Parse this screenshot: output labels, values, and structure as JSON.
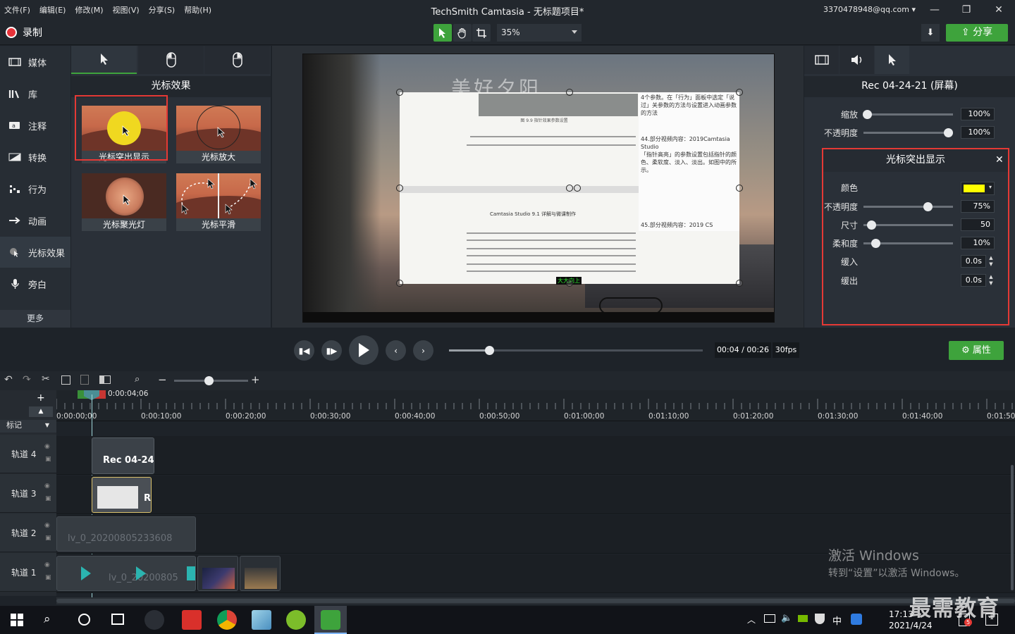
{
  "app": {
    "title": "TechSmith Camtasia - 无标题项目*",
    "menu": [
      "文件(F)",
      "编辑(E)",
      "修改(M)",
      "视图(V)",
      "分享(S)",
      "帮助(H)"
    ],
    "account": "3370478948@qq.com",
    "window_buttons": [
      "—",
      "❐",
      "✕"
    ]
  },
  "toolbar": {
    "record_label": "录制",
    "zoom": "35%",
    "share_label": "分享"
  },
  "sidebar": {
    "items": [
      {
        "label": "媒体",
        "icon": "film-icon"
      },
      {
        "label": "库",
        "icon": "library-icon"
      },
      {
        "label": "注释",
        "icon": "annotation-icon"
      },
      {
        "label": "转换",
        "icon": "transition-icon"
      },
      {
        "label": "行为",
        "icon": "behavior-icon"
      },
      {
        "label": "动画",
        "icon": "animation-icon"
      },
      {
        "label": "光标效果",
        "icon": "cursor-effect-icon",
        "active": true
      },
      {
        "label": "旁白",
        "icon": "microphone-icon"
      }
    ],
    "more_label": "更多"
  },
  "effects": {
    "title": "光标效果",
    "cards": [
      {
        "label": "光标突出显示"
      },
      {
        "label": "光标放大"
      },
      {
        "label": "光标聚光灯"
      },
      {
        "label": "光标平滑"
      }
    ]
  },
  "canvas": {
    "video_title": "美好夕阳",
    "doc_heading": "Camtasia Studio 9.1 详解与微课制作",
    "doc_caption": "图 9.9 指针效果参数设置",
    "doc_right": [
      "4个参数。在「行为」面板中选定「说过」关参数的方法与设置进入动画参数的方法",
      "44.部分视频内容：2019Camtasia Studio",
      "「指针高亮」的参数设置包括指针的颜色、柔软度、淡入、淡出。如图中的所示。",
      "45.部分视频内容：2019 CS"
    ],
    "subtitle": "大大向上"
  },
  "properties": {
    "tabs": [
      "film-icon",
      "audio-icon",
      "cursor-icon"
    ],
    "clip_name": "Rec 04-24-21 (屏幕)",
    "scale_label": "缩放",
    "scale_value": "100%",
    "scale_level": 0.0,
    "opacity_label": "不透明度",
    "opacity_value": "100%",
    "opacity_level": 1.0,
    "cursor_panel": {
      "title": "光标突出显示",
      "color_label": "颜色",
      "color": "#ffff00",
      "opacity_label": "不透明度",
      "opacity_value": "75%",
      "opacity_level": 0.75,
      "size_label": "尺寸",
      "size_value": "50",
      "size_level": 0.05,
      "softness_label": "柔和度",
      "softness_value": "10%",
      "softness_level": 0.1,
      "fade_in_label": "缓入",
      "fade_in_value": "0.0s",
      "fade_out_label": "缓出",
      "fade_out_value": "0.0s"
    }
  },
  "playback": {
    "timecode": "00:04 / 00:26",
    "fps": "30fps",
    "progress": 0.15,
    "properties_label": "属性"
  },
  "timeline": {
    "playhead_time": "0:00:04;06",
    "ticks": [
      "0:00:00;00",
      "0:00:10;00",
      "0:00:20;00",
      "0:00:30;00",
      "0:00:40;00",
      "0:00:50;00",
      "0:01:00;00",
      "0:01:10;00",
      "0:01:20;00",
      "0:01:30;00",
      "0:01:40;00",
      "0:01:50;0"
    ],
    "markers_label": "标记",
    "tracks": [
      {
        "label": "轨道 4",
        "clip": "Rec 04-24-"
      },
      {
        "label": "轨道 3",
        "clip": "R"
      },
      {
        "label": "轨道 2",
        "clip": "lv_0_20200805233608"
      },
      {
        "label": "轨道 1",
        "clip": "lv_0_20200805"
      }
    ]
  },
  "watermark": {
    "line1": "激活 Windows",
    "line2": "转到“设置”以激活 Windows。",
    "brand": "最需教育"
  },
  "taskbar": {
    "time": "17:13",
    "date": "2021/4/24",
    "ime": "中",
    "notification_count": "5",
    "action_count": "1"
  }
}
